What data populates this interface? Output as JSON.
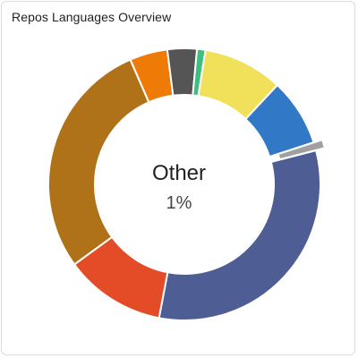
{
  "card": {
    "title": "Repos Languages Overview"
  },
  "center": {
    "name": "Other",
    "value": "1%"
  },
  "chart_data": {
    "type": "pie",
    "hole": "donut",
    "highlighted": "Other",
    "slices": [
      {
        "share": 0.045,
        "color": "#ee7b06"
      },
      {
        "share": 0.035,
        "color": "#555555"
      },
      {
        "share": 0.01,
        "color": "#3dbf7f"
      },
      {
        "share": 0.095,
        "color": "#f1e05a"
      },
      {
        "share": 0.08,
        "color": "#3178c6"
      },
      {
        "share": 0.01,
        "color": "#a0a0a0",
        "label": "Other",
        "value": "1%"
      },
      {
        "share": 0.32,
        "color": "#4f5d95"
      },
      {
        "share": 0.12,
        "color": "#e34c26"
      },
      {
        "share": 0.285,
        "color": "#b07219"
      }
    ]
  }
}
